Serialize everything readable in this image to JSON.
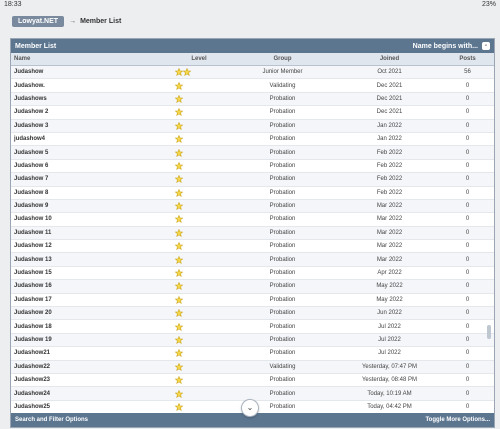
{
  "status_bar": {
    "time": "18:33",
    "battery": "23%"
  },
  "breadcrumb": {
    "site": "Lowyat.NET",
    "separator": "→",
    "current": "Member List"
  },
  "panel": {
    "title": "Member List",
    "name_begins_label": "Name begins with...",
    "name_begins_value": "-",
    "columns": {
      "name": "Name",
      "level": "Level",
      "group": "Group",
      "joined": "Joined",
      "posts": "Posts"
    },
    "rows": [
      {
        "name": "Judashow",
        "stars": 2,
        "group": "Junior Member",
        "joined": "Oct 2021",
        "posts": "56"
      },
      {
        "name": "Judashow.",
        "stars": 1,
        "group": "Validating",
        "joined": "Dec 2021",
        "posts": "0"
      },
      {
        "name": "Judashows",
        "stars": 1,
        "group": "Probation",
        "joined": "Dec 2021",
        "posts": "0"
      },
      {
        "name": "Judashow 2",
        "stars": 1,
        "group": "Probation",
        "joined": "Dec 2021",
        "posts": "0"
      },
      {
        "name": "Judashow 3",
        "stars": 1,
        "group": "Probation",
        "joined": "Jan 2022",
        "posts": "0"
      },
      {
        "name": "judashow4",
        "stars": 1,
        "group": "Probation",
        "joined": "Jan 2022",
        "posts": "0"
      },
      {
        "name": "Judashow 5",
        "stars": 1,
        "group": "Probation",
        "joined": "Feb 2022",
        "posts": "0"
      },
      {
        "name": "Judashow 6",
        "stars": 1,
        "group": "Probation",
        "joined": "Feb 2022",
        "posts": "0"
      },
      {
        "name": "Judashow 7",
        "stars": 1,
        "group": "Probation",
        "joined": "Feb 2022",
        "posts": "0"
      },
      {
        "name": "Judashow 8",
        "stars": 1,
        "group": "Probation",
        "joined": "Feb 2022",
        "posts": "0"
      },
      {
        "name": "Judashow 9",
        "stars": 1,
        "group": "Probation",
        "joined": "Mar 2022",
        "posts": "0"
      },
      {
        "name": "Judashow 10",
        "stars": 1,
        "group": "Probation",
        "joined": "Mar 2022",
        "posts": "0"
      },
      {
        "name": "Judashow 11",
        "stars": 1,
        "group": "Probation",
        "joined": "Mar 2022",
        "posts": "0"
      },
      {
        "name": "Judashow 12",
        "stars": 1,
        "group": "Probation",
        "joined": "Mar 2022",
        "posts": "0"
      },
      {
        "name": "Judashow 13",
        "stars": 1,
        "group": "Probation",
        "joined": "Mar 2022",
        "posts": "0"
      },
      {
        "name": "Judashow 15",
        "stars": 1,
        "group": "Probation",
        "joined": "Apr 2022",
        "posts": "0"
      },
      {
        "name": "Judashow 16",
        "stars": 1,
        "group": "Probation",
        "joined": "May 2022",
        "posts": "0"
      },
      {
        "name": "Judashow 17",
        "stars": 1,
        "group": "Probation",
        "joined": "May 2022",
        "posts": "0"
      },
      {
        "name": "Judashow 20",
        "stars": 1,
        "group": "Probation",
        "joined": "Jun 2022",
        "posts": "0"
      },
      {
        "name": "Judashow 18",
        "stars": 1,
        "group": "Probation",
        "joined": "Jul 2022",
        "posts": "0"
      },
      {
        "name": "Judashow 19",
        "stars": 1,
        "group": "Probation",
        "joined": "Jul 2022",
        "posts": "0"
      },
      {
        "name": "Judashow21",
        "stars": 1,
        "group": "Probation",
        "joined": "Jul 2022",
        "posts": "0"
      },
      {
        "name": "Judashow22",
        "stars": 1,
        "group": "Validating",
        "joined": "Yesterday, 07:47 PM",
        "posts": "0"
      },
      {
        "name": "Judashow23",
        "stars": 1,
        "group": "Probation",
        "joined": "Yesterday, 08:48 PM",
        "posts": "0"
      },
      {
        "name": "Judashow24",
        "stars": 1,
        "group": "Probation",
        "joined": "Today, 10:19 AM",
        "posts": "0"
      },
      {
        "name": "Judashow25",
        "stars": 1,
        "group": "Probation",
        "joined": "Today, 04:42 PM",
        "posts": "0"
      }
    ],
    "footer": {
      "left": "Search and Filter Options",
      "right": "Toggle More Options..."
    }
  },
  "colors": {
    "header_bg": "#5c7690",
    "star_fill": "#f7d84a",
    "star_stroke": "#c9a21a"
  }
}
